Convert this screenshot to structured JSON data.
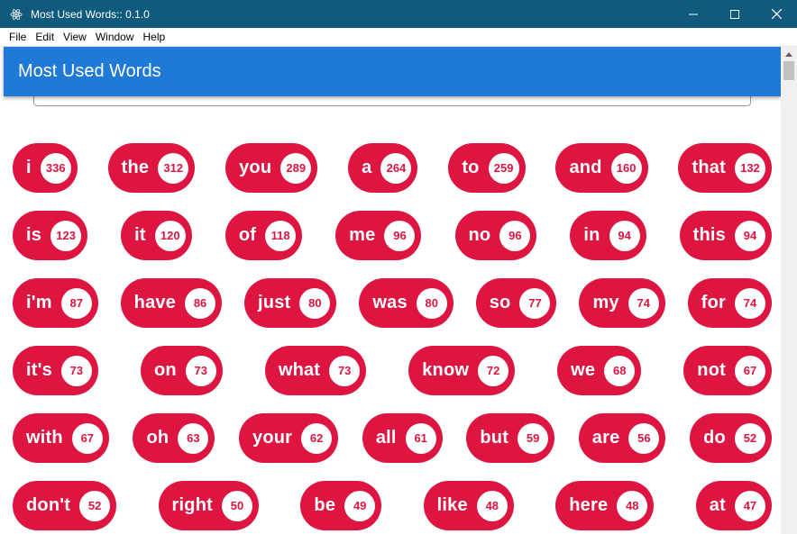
{
  "window": {
    "title": "Most Used Words:: 0.1.0",
    "controls": {
      "minimize": "—",
      "maximize": "☐",
      "close": "✕"
    }
  },
  "menu": [
    "File",
    "Edit",
    "View",
    "Window",
    "Help"
  ],
  "appbar": {
    "title": "Most Used Words"
  },
  "colors": {
    "titlebar": "#0f5a7d",
    "appbar": "#1e7ad6",
    "chip": "#dd1540",
    "count_bg": "#ffffff"
  },
  "rows": [
    [
      {
        "word": "i",
        "count": "336"
      },
      {
        "word": "the",
        "count": "312"
      },
      {
        "word": "you",
        "count": "289"
      },
      {
        "word": "a",
        "count": "264"
      },
      {
        "word": "to",
        "count": "259"
      },
      {
        "word": "and",
        "count": "160"
      },
      {
        "word": "that",
        "count": "132"
      }
    ],
    [
      {
        "word": "is",
        "count": "123"
      },
      {
        "word": "it",
        "count": "120"
      },
      {
        "word": "of",
        "count": "118"
      },
      {
        "word": "me",
        "count": "96"
      },
      {
        "word": "no",
        "count": "96"
      },
      {
        "word": "in",
        "count": "94"
      },
      {
        "word": "this",
        "count": "94"
      }
    ],
    [
      {
        "word": "i'm",
        "count": "87"
      },
      {
        "word": "have",
        "count": "86"
      },
      {
        "word": "just",
        "count": "80"
      },
      {
        "word": "was",
        "count": "80"
      },
      {
        "word": "so",
        "count": "77"
      },
      {
        "word": "my",
        "count": "74"
      },
      {
        "word": "for",
        "count": "74"
      }
    ],
    [
      {
        "word": "it's",
        "count": "73"
      },
      {
        "word": "on",
        "count": "73"
      },
      {
        "word": "what",
        "count": "73"
      },
      {
        "word": "know",
        "count": "72"
      },
      {
        "word": "we",
        "count": "68"
      },
      {
        "word": "not",
        "count": "67"
      }
    ],
    [
      {
        "word": "with",
        "count": "67"
      },
      {
        "word": "oh",
        "count": "63"
      },
      {
        "word": "your",
        "count": "62"
      },
      {
        "word": "all",
        "count": "61"
      },
      {
        "word": "but",
        "count": "59"
      },
      {
        "word": "are",
        "count": "56"
      },
      {
        "word": "do",
        "count": "52"
      }
    ],
    [
      {
        "word": "don't",
        "count": "52"
      },
      {
        "word": "right",
        "count": "50"
      },
      {
        "word": "be",
        "count": "49"
      },
      {
        "word": "like",
        "count": "48"
      },
      {
        "word": "here",
        "count": "48"
      },
      {
        "word": "at",
        "count": "47"
      }
    ]
  ]
}
